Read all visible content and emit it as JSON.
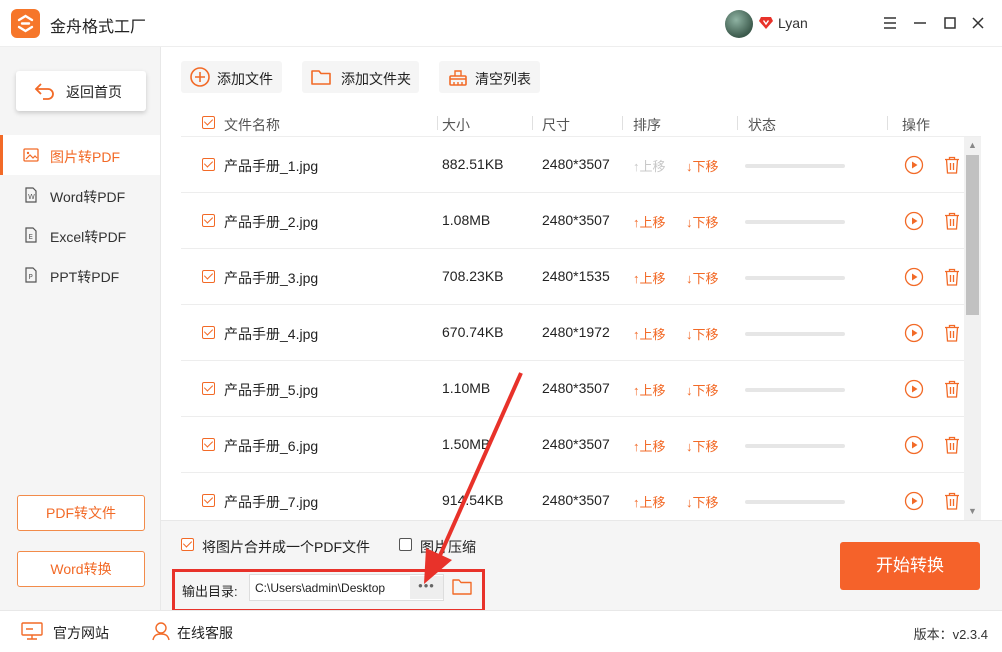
{
  "app": {
    "title": "金舟格式工厂",
    "username": "Lyan",
    "brand_color": "#f26a27"
  },
  "sidebar": {
    "home_label": "返回首页",
    "items": [
      {
        "label": "图片转PDF",
        "icon": "image-icon",
        "active": true
      },
      {
        "label": "Word转PDF",
        "icon": "word-file-icon",
        "active": false
      },
      {
        "label": "Excel转PDF",
        "icon": "excel-file-icon",
        "active": false
      },
      {
        "label": "PPT转PDF",
        "icon": "ppt-file-icon",
        "active": false
      }
    ],
    "bottom_buttons": [
      "PDF转文件",
      "Word转换"
    ]
  },
  "toolbar": {
    "add_file": "添加文件",
    "add_folder": "添加文件夹",
    "clear_list": "清空列表"
  },
  "table": {
    "headers": {
      "name": "文件名称",
      "size": "大小",
      "dimensions": "尺寸",
      "order": "排序",
      "status": "状态",
      "actions": "操作"
    },
    "move_up": "上移",
    "move_down": "下移",
    "rows": [
      {
        "name": "产品手册_1.jpg",
        "size": "882.51KB",
        "dims": "2480*3507",
        "progress": 0
      },
      {
        "name": "产品手册_2.jpg",
        "size": "1.08MB",
        "dims": "2480*3507",
        "progress": 0
      },
      {
        "name": "产品手册_3.jpg",
        "size": "708.23KB",
        "dims": "2480*1535",
        "progress": 0
      },
      {
        "name": "产品手册_4.jpg",
        "size": "670.74KB",
        "dims": "2480*1972",
        "progress": 0
      },
      {
        "name": "产品手册_5.jpg",
        "size": "1.10MB",
        "dims": "2480*3507",
        "progress": 0
      },
      {
        "name": "产品手册_6.jpg",
        "size": "1.50MB",
        "dims": "2480*3507",
        "progress": 0
      },
      {
        "name": "产品手册_7.jpg",
        "size": "914.54KB",
        "dims": "2480*3507",
        "progress": 0
      }
    ]
  },
  "options": {
    "merge_label": "将图片合并成一个PDF文件",
    "merge_checked": true,
    "compress_label": "图片压缩",
    "compress_checked": false
  },
  "output": {
    "label": "输出目录:",
    "path": "C:\\Users\\admin\\Desktop",
    "more": "•••"
  },
  "start_button": "开始转换",
  "statusbar": {
    "website": "官方网站",
    "support": "在线客服",
    "version": "版本：v2.3.4"
  }
}
